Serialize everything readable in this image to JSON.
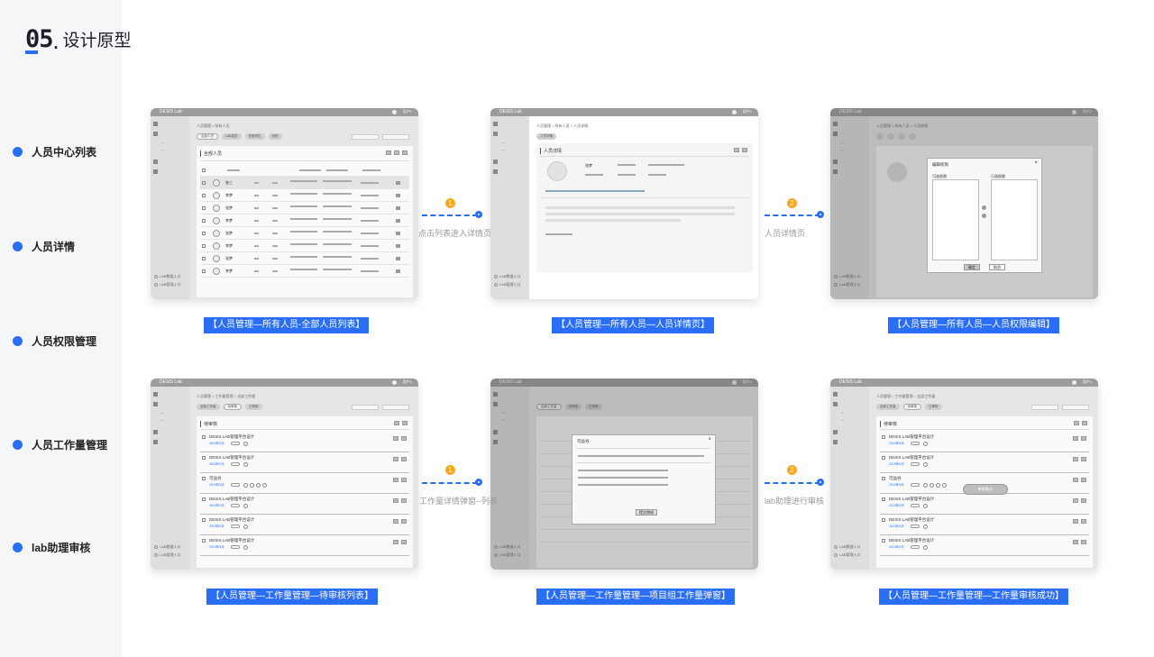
{
  "header": {
    "number": "05",
    "dot": ".",
    "title": "设计原型"
  },
  "nav": [
    "人员中心列表",
    "人员详情",
    "人员权限管理",
    "人员工作量管理",
    "lab助理审核"
  ],
  "app": {
    "brand": "DESIS Lab",
    "user": "用户1",
    "footer": [
      "LAB数据入口",
      "LAB管理入口"
    ]
  },
  "connectors": [
    {
      "badge": "1",
      "label": "点击列表进入详情页"
    },
    {
      "badge": "2",
      "label": "人员详情页"
    },
    {
      "badge": "1",
      "label": "工作量详情弹窗--列表"
    },
    {
      "badge": "2",
      "label": "lab助理进行审核"
    }
  ],
  "captions": [
    "【人员管理—所有人员-全部人员列表】",
    "【人员管理—所有人员—人员详情页】",
    "【人员管理—所有人员—人员权限编辑】",
    "【人员管理—工作量管理—待审核列表】",
    "【人员管理—工作量管理—项目组工作量弹窗】",
    "【人员管理—工作量管理—工作量审核成功】"
  ],
  "screens": {
    "list": {
      "breadcrumb": "人员管理 > 所有人员",
      "chips": [
        "全部人员",
        "LAB成员",
        "在职学生",
        "其他"
      ],
      "card_title": "全部人员",
      "names": [
        "张三",
        "李梦",
        "张梦",
        "李梦",
        "张梦",
        "李梦",
        "张梦",
        "李梦"
      ]
    },
    "detail": {
      "breadcrumb": "人员管理 > 所有人员 > 人员详情",
      "chip": "人员详情",
      "card_title": "人员详情",
      "name": "张梦"
    },
    "perm": {
      "breadcrumb": "人员管理 > 所有人员 > 人员权限",
      "modal_title": "编辑权限",
      "left": "可选权限",
      "right": "已选权限",
      "ok": "确定",
      "cancel": "取消"
    },
    "work": {
      "breadcrumb": "人员管理 > 工作量管理 > 全部工作量",
      "chips": [
        "全部工作量",
        "待审核",
        "已审核"
      ],
      "card_title": "待审核",
      "items": [
        {
          "title": "DESIS LAB管理平台设计",
          "date": "2019年9月"
        },
        {
          "title": "DESIS LAB管理平台设计",
          "date": "2019年9月"
        },
        {
          "title": "可益谷",
          "date": "2019年9月"
        },
        {
          "title": "DESIS LAB管理平台设计",
          "date": "2019年9月"
        },
        {
          "title": "DESIS LAB管理平台设计",
          "date": "2019年9月"
        },
        {
          "title": "DESIS LAB管理平台设计",
          "date": "2019年9月"
        }
      ]
    },
    "popup": {
      "modal_title": "可益谷",
      "submit": "提交审核",
      "chips": [
        "全部工作量",
        "待审核",
        "已审核"
      ]
    },
    "success": {
      "toast": "审核通过!"
    }
  }
}
